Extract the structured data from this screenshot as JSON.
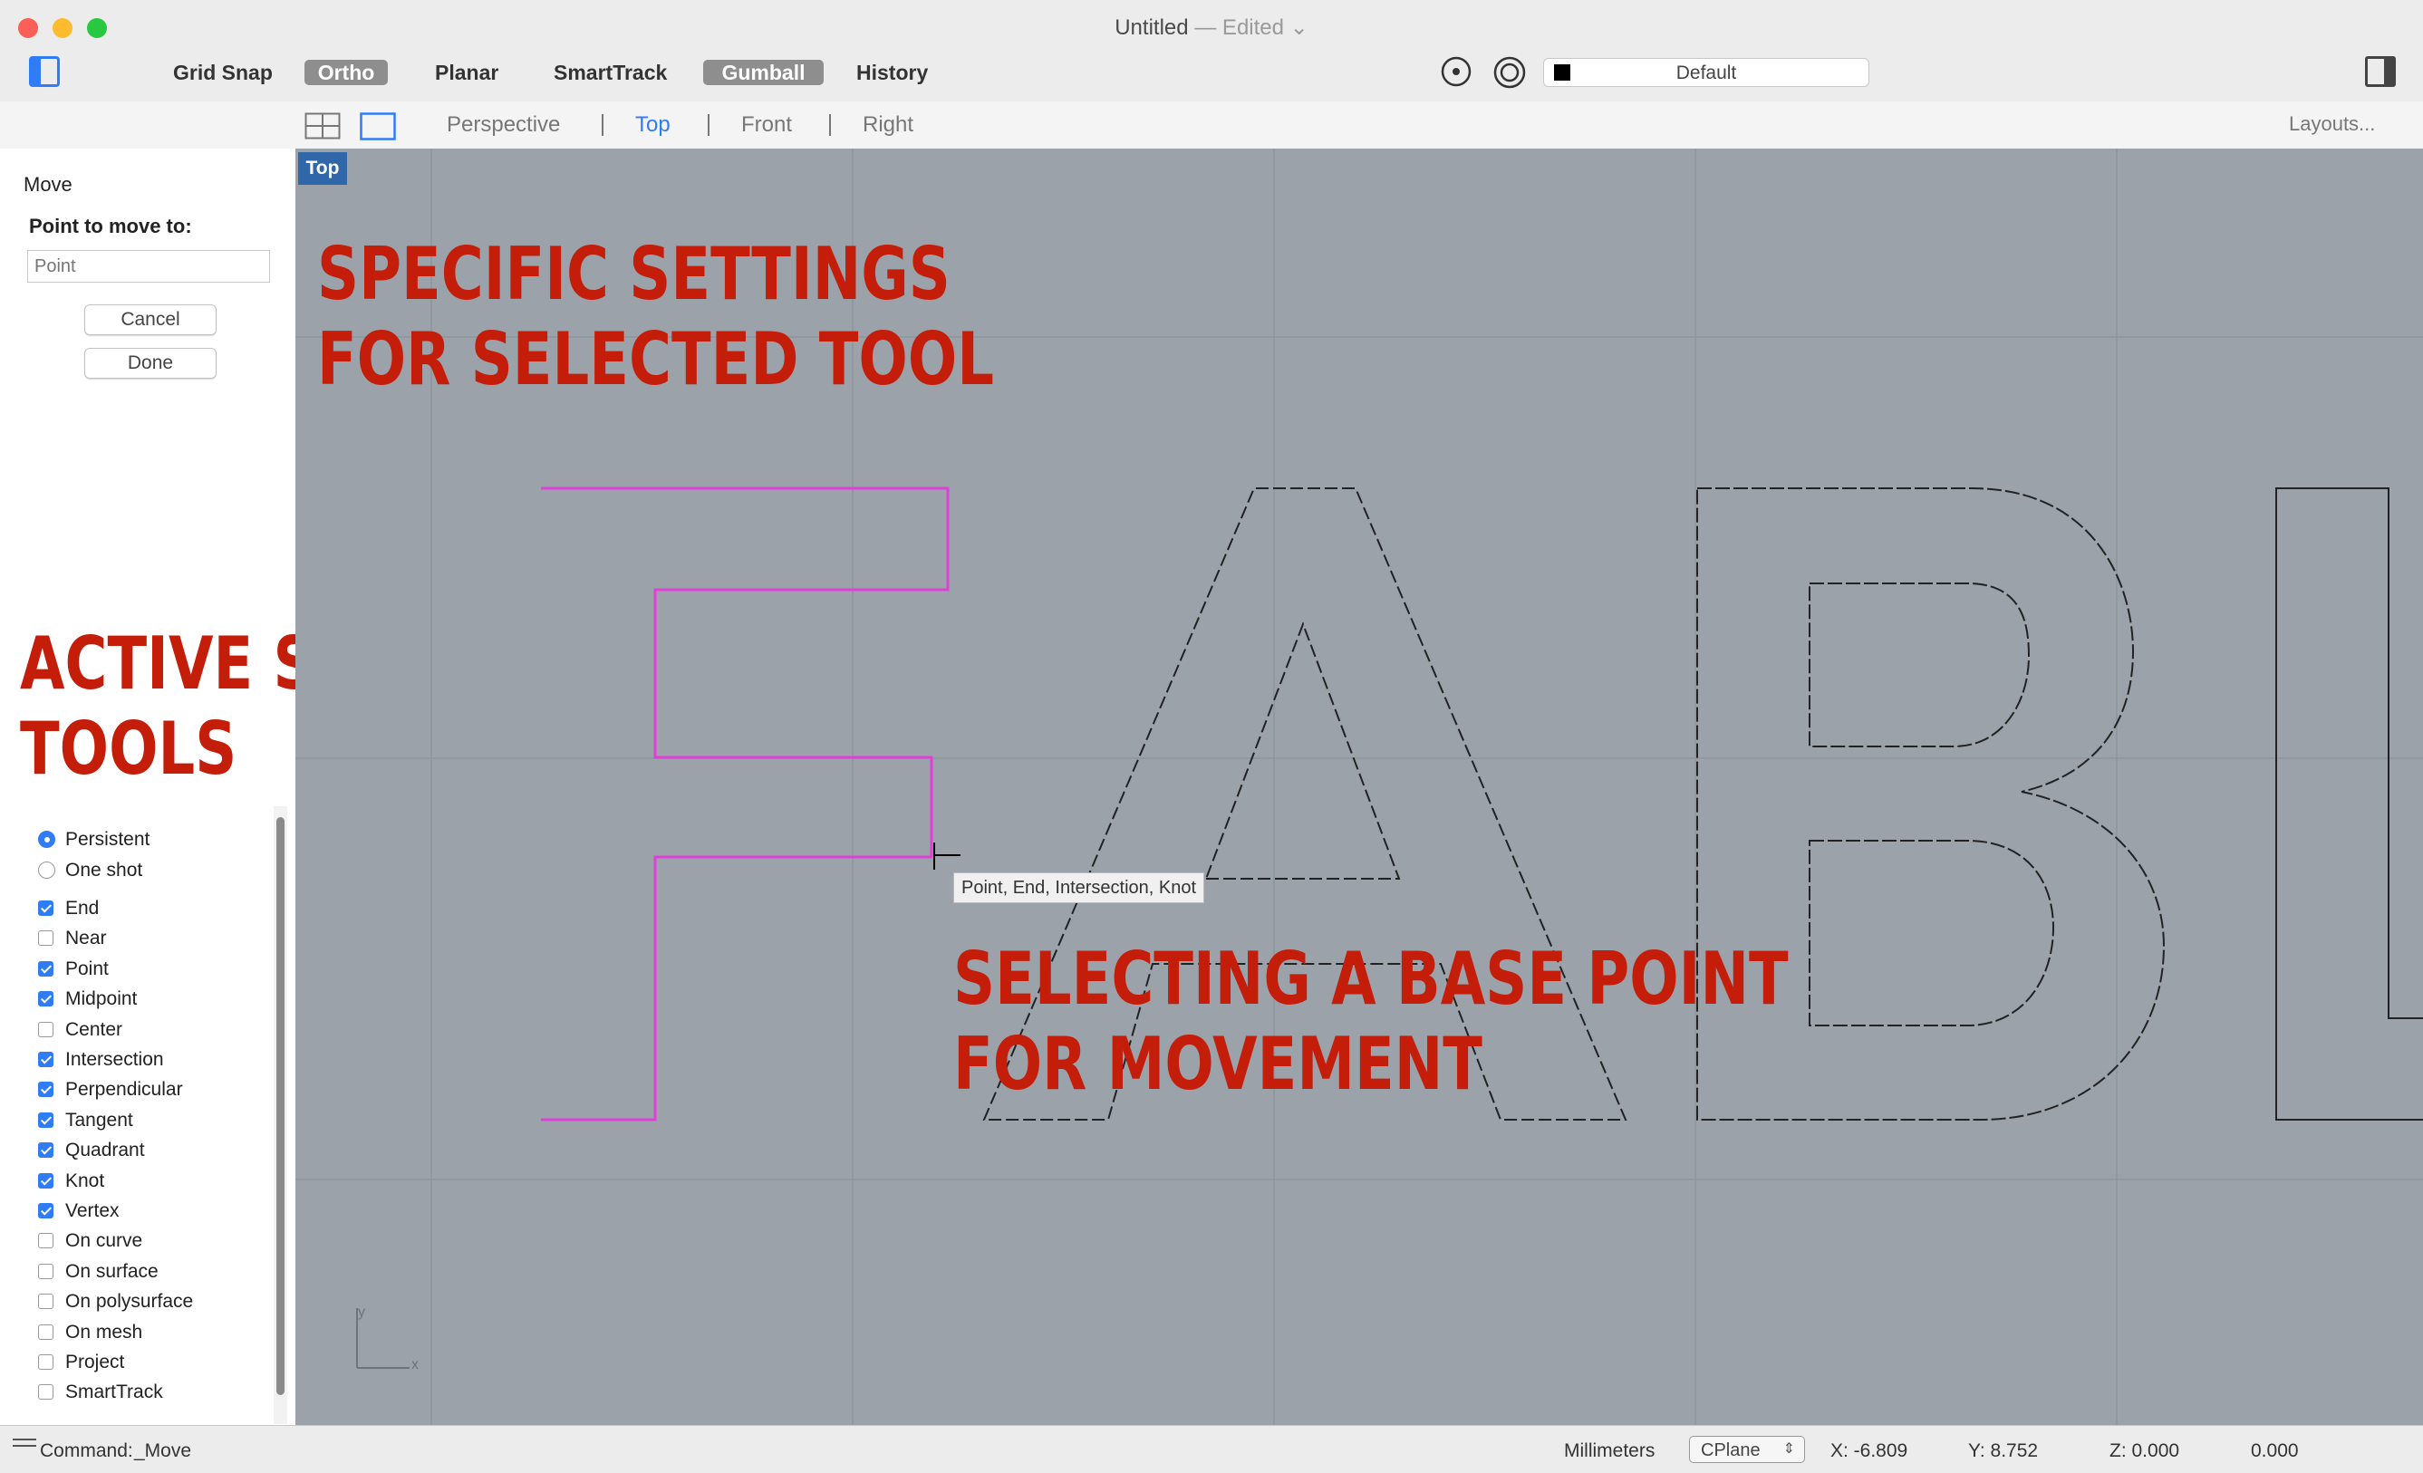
{
  "window": {
    "title": "Untitled",
    "edited": " — Edited ⌄"
  },
  "toolbar": {
    "grid_snap": "Grid Snap",
    "ortho": "Ortho",
    "planar": "Planar",
    "smarttrack": "SmartTrack",
    "gumball": "Gumball",
    "history": "History",
    "layer": "Default"
  },
  "viewbar": {
    "tabs": [
      "Perspective",
      "Top",
      "Front",
      "Right"
    ],
    "active_tab": "Top",
    "layouts": "Layouts..."
  },
  "viewport": {
    "label": "Top",
    "osnap_tooltip": "Point, End, Intersection, Knot",
    "axis_y": "y",
    "axis_x": "x"
  },
  "command_panel": {
    "title": "Move",
    "prompt": "Point to move to:",
    "input_placeholder": "Point",
    "cancel": "Cancel",
    "done": "Done"
  },
  "snap_mode": [
    {
      "label": "Persistent",
      "selected": true
    },
    {
      "label": "One shot",
      "selected": false
    }
  ],
  "osnaps": [
    {
      "label": "End",
      "checked": true
    },
    {
      "label": "Near",
      "checked": false
    },
    {
      "label": "Point",
      "checked": true
    },
    {
      "label": "Midpoint",
      "checked": true
    },
    {
      "label": "Center",
      "checked": false
    },
    {
      "label": "Intersection",
      "checked": true
    },
    {
      "label": "Perpendicular",
      "checked": true
    },
    {
      "label": "Tangent",
      "checked": true
    },
    {
      "label": "Quadrant",
      "checked": true
    },
    {
      "label": "Knot",
      "checked": true
    },
    {
      "label": "Vertex",
      "checked": true
    },
    {
      "label": "On curve",
      "checked": false
    },
    {
      "label": "On surface",
      "checked": false
    },
    {
      "label": "On polysurface",
      "checked": false
    },
    {
      "label": "On mesh",
      "checked": false
    },
    {
      "label": "Project",
      "checked": false
    },
    {
      "label": "SmartTrack",
      "checked": false
    }
  ],
  "annotations": {
    "settings_line1": "SPECIFIC SETTINGS",
    "settings_line2": "FOR SELECTED TOOL",
    "snap_line1": "ACTIVE SNAP",
    "snap_line2": "TOOLS",
    "base_line1": "SELECTING A BASE POINT",
    "base_line2": "FOR MOVEMENT"
  },
  "status": {
    "command_label": "Command:",
    "command_value": "_Move",
    "units": "Millimeters",
    "cplane": "CPlane",
    "x": "X: -6.809",
    "y": "Y: 8.752",
    "z": "Z: 0.000",
    "d": "0.000"
  },
  "colors": {
    "selected_curve": "#e040d8",
    "annotation": "#c41e0b",
    "accent": "#2f7cf6",
    "viewport_bg": "#9ba2aa"
  }
}
